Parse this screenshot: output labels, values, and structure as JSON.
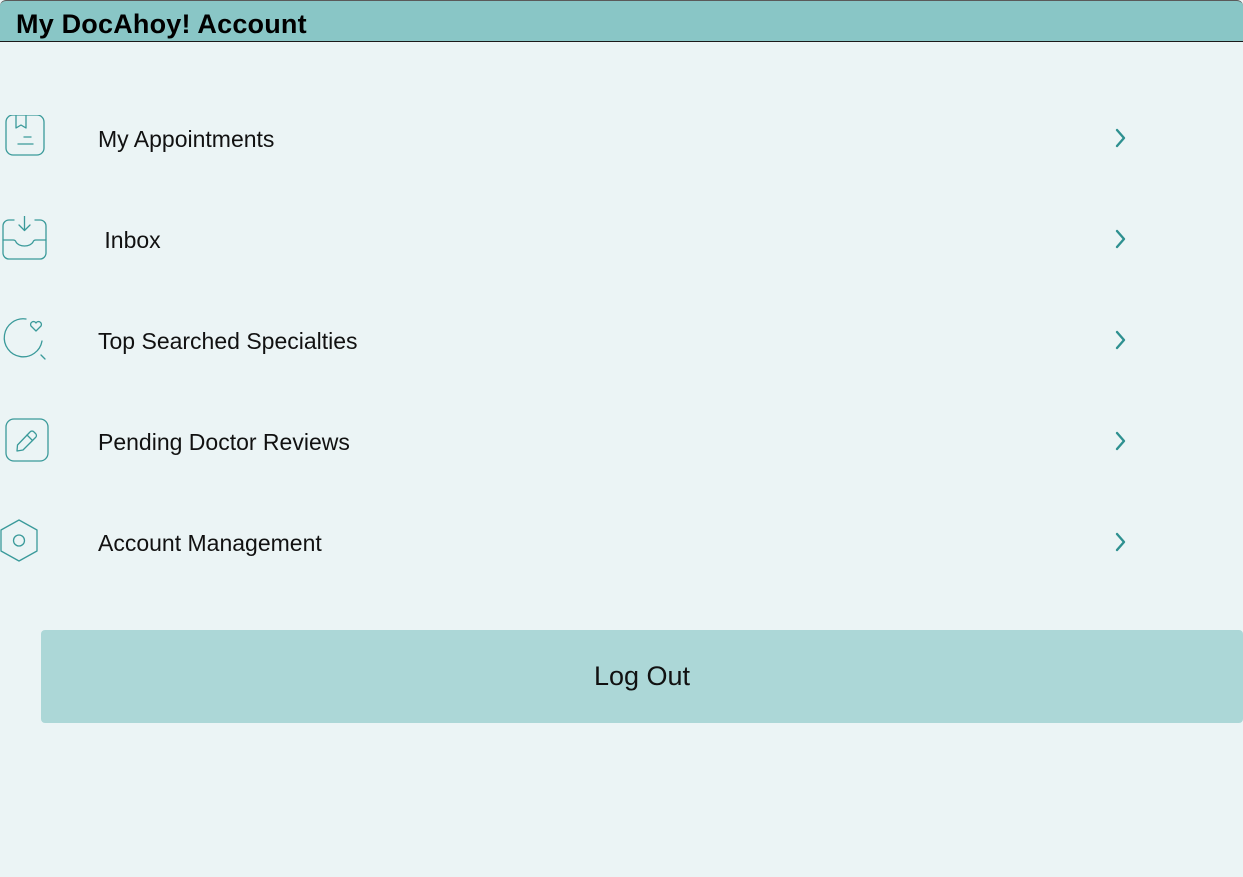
{
  "header": {
    "title": "My DocAhoy! Account"
  },
  "menu": {
    "items": [
      {
        "label": "My Appointments",
        "icon": "appointments-bookmark-icon"
      },
      {
        "label": " Inbox",
        "icon": "inbox-download-icon"
      },
      {
        "label": "Top Searched Specialties",
        "icon": "heart-search-icon"
      },
      {
        "label": "Pending Doctor Reviews",
        "icon": "edit-pencil-icon"
      },
      {
        "label": "Account Management",
        "icon": "settings-hexagon-icon"
      }
    ],
    "chevron_icon": "chevron-right-icon"
  },
  "logout": {
    "label": "Log Out"
  },
  "colors": {
    "background": "#ebf4f5",
    "header": "#89c6c6",
    "button": "#acd7d7",
    "icon_stroke": "#3a9a9a",
    "chevron": "#2e9090"
  }
}
